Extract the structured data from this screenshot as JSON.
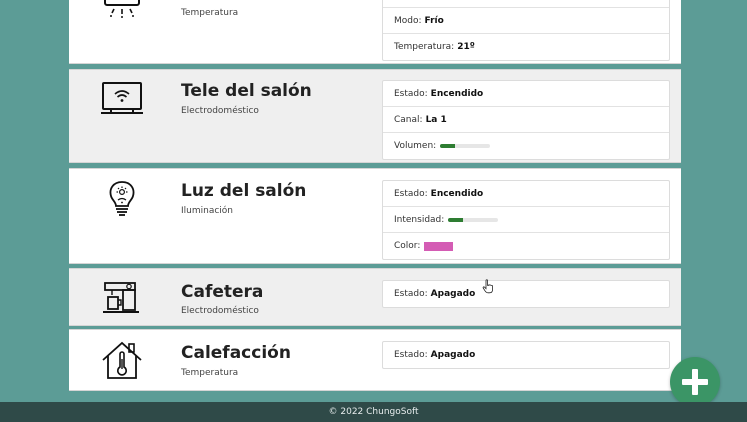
{
  "devices": [
    {
      "name": "",
      "type": "Temperatura",
      "icon": "air-conditioner-icon",
      "props": [
        {
          "label": "Modo:",
          "value": "Frío"
        },
        {
          "label": "Temperatura:",
          "value": "21º"
        }
      ]
    },
    {
      "name": "Tele del salón",
      "type": "Electrodoméstico",
      "icon": "television-icon",
      "props": [
        {
          "label": "Estado:",
          "value": "Encendido"
        },
        {
          "label": "Canal:",
          "value": "La 1"
        },
        {
          "label": "Volumen:",
          "value": "",
          "level": 0.3
        }
      ]
    },
    {
      "name": "Luz del salón",
      "type": "Iluminación",
      "icon": "light-bulb-icon",
      "props": [
        {
          "label": "Estado:",
          "value": "Encendido"
        },
        {
          "label": "Intensidad:",
          "value": "",
          "level": 0.3
        },
        {
          "label": "Color:",
          "value": "",
          "color": "#d45cb4"
        }
      ]
    },
    {
      "name": "Cafetera",
      "type": "Electrodoméstico",
      "icon": "coffee-maker-icon",
      "props": [
        {
          "label": "Estado:",
          "value": "Apagado"
        }
      ]
    },
    {
      "name": "Calefacción",
      "type": "Temperatura",
      "icon": "house-thermometer-icon",
      "props": [
        {
          "label": "Estado:",
          "value": "Apagado"
        }
      ]
    }
  ],
  "add_button": {
    "icon": "plus-icon"
  },
  "footer": {
    "text": "© 2022 ChungoSoft"
  },
  "colors": {
    "background": "#5c9c96",
    "fab": "#3b9566",
    "level_bar": "#2e7d32",
    "footer": "#2f4a48"
  }
}
